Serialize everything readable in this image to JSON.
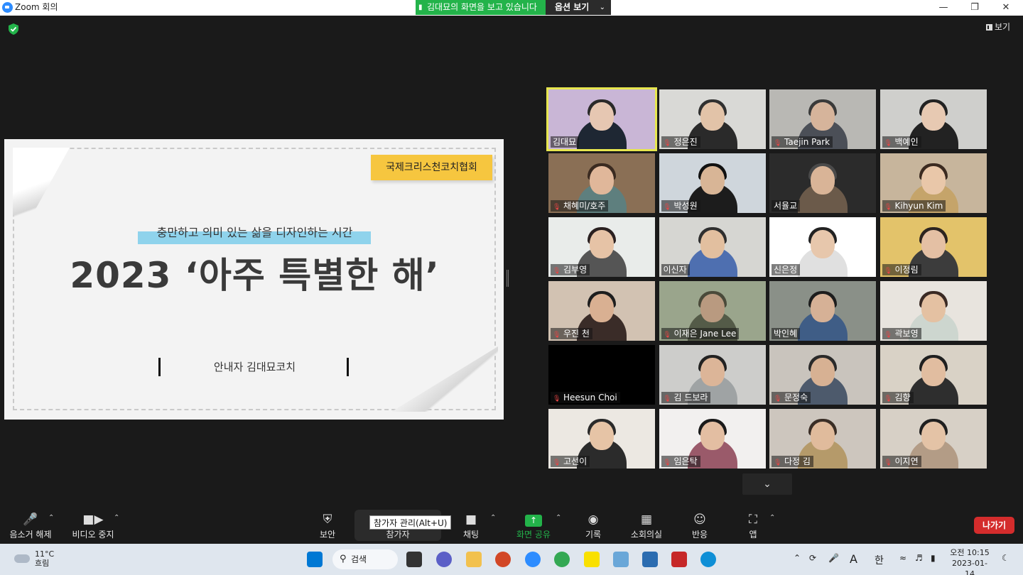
{
  "window": {
    "title": "Zoom 회의"
  },
  "share_banner": {
    "text": "김대묘의 화면을 보고 있습니다",
    "options_label": "옵션 보기"
  },
  "view_button": {
    "label": "보기"
  },
  "slide": {
    "organization": "국제크리스천코치협회",
    "subtitle": "충만하고 의미 있는 삶을 디자인하는 시간",
    "title": "2023 ‘아주 특별한 해’",
    "presenter": "안내자  김대묘코치"
  },
  "participants": [
    {
      "name": "김대묘",
      "muted": false
    },
    {
      "name": "정은진",
      "muted": true
    },
    {
      "name": "Taejin Park",
      "muted": true
    },
    {
      "name": "백예인",
      "muted": true
    },
    {
      "name": "채혜미/호주",
      "muted": true
    },
    {
      "name": "박성원",
      "muted": true
    },
    {
      "name": "서율교",
      "muted": false
    },
    {
      "name": "Kihyun Kim",
      "muted": true
    },
    {
      "name": "김부영",
      "muted": true
    },
    {
      "name": "이신자",
      "muted": false
    },
    {
      "name": "신은정",
      "muted": false
    },
    {
      "name": "이정림",
      "muted": true
    },
    {
      "name": "우진 천",
      "muted": true
    },
    {
      "name": "이재은 Jane Lee",
      "muted": true
    },
    {
      "name": "박인혜",
      "muted": false
    },
    {
      "name": "곽보영",
      "muted": true
    },
    {
      "name": "Heesun Choi",
      "muted": true
    },
    {
      "name": "김 드보라",
      "muted": true
    },
    {
      "name": "문정숙",
      "muted": true
    },
    {
      "name": "김향",
      "muted": true
    },
    {
      "name": "고선이",
      "muted": true
    },
    {
      "name": "임은탁",
      "muted": true
    },
    {
      "name": "다정 김",
      "muted": true
    },
    {
      "name": "이지연",
      "muted": true
    }
  ],
  "toolbar": {
    "unmute": "음소거 해제",
    "stop_video": "비디오 중지",
    "security": "보안",
    "participants": "참가자",
    "participants_tooltip": "참가자 관리(Alt+U)",
    "chat": "채팅",
    "share_screen": "화면 공유",
    "record": "기록",
    "breakout": "소회의실",
    "reactions": "반응",
    "apps": "앱",
    "leave": "나가기"
  },
  "taskbar": {
    "weather_temp": "11°C",
    "weather_desc": "흐림",
    "search_label": "검색",
    "ime_mode": "A",
    "ime_lang": "한",
    "time": "오전 10:15",
    "date": "2023-01-14"
  },
  "colors": {
    "share_green": "#23b34a",
    "active_speaker": "#e7e64f",
    "leave_red": "#d42c2c",
    "mute_red": "#e84545"
  }
}
